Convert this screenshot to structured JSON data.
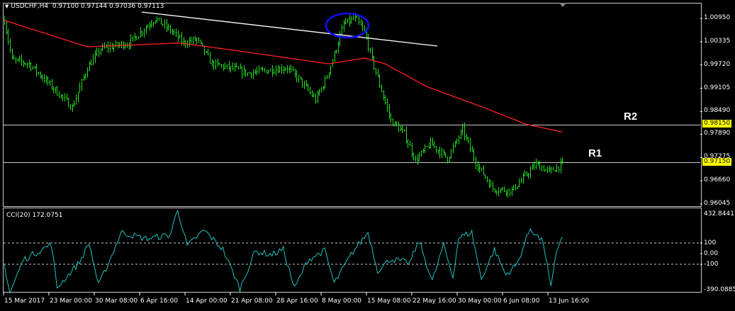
{
  "header": {
    "symbol": "USDCHF,H4",
    "open": "0.97100",
    "high": "0.97144",
    "low": "0.97036",
    "close": "0.97113"
  },
  "price_axis": [
    "1.00950",
    "1.00335",
    "0.99720",
    "0.99105",
    "0.98490",
    "0.97890",
    "0.97275",
    "0.96660",
    "0.96045"
  ],
  "levels": [
    {
      "name": "R2",
      "price": "0.98150",
      "value": 0.9815
    },
    {
      "name": "R1",
      "price": "0.97150",
      "value": 0.9715
    }
  ],
  "cci": {
    "label": "CCI(20) 172.0751",
    "axis": [
      "432.8441",
      "100",
      "0.00",
      "-100",
      "-390.0885"
    ]
  },
  "time_axis": [
    "15 Mar 2017",
    "23 Mar 00:00",
    "30 Mar 08:00",
    "6 Apr 16:00",
    "14 Apr 00:00",
    "21 Apr 08:00",
    "28 Apr 16:00",
    "8 May 00:00",
    "15 May 08:00",
    "22 May 16:00",
    "30 May 00:00",
    "6 Jun 08:00",
    "13 Jun 16:00"
  ],
  "colors": {
    "bars": "#22dd22",
    "ma": "#ff2020",
    "cci": "#20c0c0",
    "ellipse": "#1010ff",
    "tag": "#ffff00"
  },
  "chart_data": {
    "type": "ohlc",
    "price_path": [
      [
        0,
        1.009
      ],
      [
        4,
        0.9985
      ],
      [
        13,
        0.9975
      ],
      [
        23,
        0.9925
      ],
      [
        36,
        0.986
      ],
      [
        44,
        0.9965
      ],
      [
        51,
        1.0015
      ],
      [
        66,
        1.003
      ],
      [
        80,
        1.0095
      ],
      [
        89,
        1.006
      ],
      [
        95,
        1.003
      ],
      [
        102,
        1.004
      ],
      [
        110,
        0.9975
      ],
      [
        123,
        0.996
      ],
      [
        129,
        0.995
      ],
      [
        142,
        0.996
      ],
      [
        150,
        0.9965
      ],
      [
        157,
        0.993
      ],
      [
        165,
        0.988
      ],
      [
        170,
        0.993
      ],
      [
        174,
        0.9985
      ],
      [
        180,
        1.008
      ],
      [
        186,
        1.0095
      ],
      [
        191,
        1.006
      ],
      [
        195,
        0.9985
      ],
      [
        199,
        0.992
      ],
      [
        205,
        0.9825
      ],
      [
        212,
        0.979
      ],
      [
        218,
        0.972
      ],
      [
        226,
        0.9765
      ],
      [
        235,
        0.9725
      ],
      [
        243,
        0.98
      ],
      [
        250,
        0.9715
      ],
      [
        259,
        0.9645
      ],
      [
        269,
        0.964
      ],
      [
        282,
        0.971
      ],
      [
        289,
        0.969
      ],
      [
        296,
        0.971
      ]
    ],
    "ma_path": [
      [
        0,
        1.009
      ],
      [
        44,
        1.002
      ],
      [
        93,
        1.003
      ],
      [
        123,
        1.001
      ],
      [
        172,
        0.9975
      ],
      [
        191,
        0.999
      ],
      [
        202,
        0.9975
      ],
      [
        224,
        0.9915
      ],
      [
        254,
        0.986
      ],
      [
        277,
        0.9815
      ],
      [
        296,
        0.9795
      ]
    ],
    "cci_path": [
      [
        0,
        -100
      ],
      [
        3,
        -370
      ],
      [
        10,
        -60
      ],
      [
        25,
        90
      ],
      [
        28,
        -320
      ],
      [
        40,
        -80
      ],
      [
        45,
        100
      ],
      [
        50,
        -300
      ],
      [
        56,
        -60
      ],
      [
        62,
        200
      ],
      [
        75,
        140
      ],
      [
        88,
        175
      ],
      [
        92,
        420
      ],
      [
        97,
        70
      ],
      [
        106,
        220
      ],
      [
        116,
        40
      ],
      [
        125,
        -330
      ],
      [
        133,
        20
      ],
      [
        142,
        -10
      ],
      [
        148,
        40
      ],
      [
        154,
        -330
      ],
      [
        161,
        -60
      ],
      [
        170,
        30
      ],
      [
        175,
        -280
      ],
      [
        185,
        20
      ],
      [
        193,
        200
      ],
      [
        198,
        -160
      ],
      [
        205,
        -50
      ],
      [
        215,
        -90
      ],
      [
        220,
        120
      ],
      [
        227,
        -260
      ],
      [
        233,
        80
      ],
      [
        238,
        -220
      ],
      [
        241,
        150
      ],
      [
        248,
        200
      ],
      [
        253,
        -240
      ],
      [
        260,
        40
      ],
      [
        266,
        -200
      ],
      [
        272,
        -100
      ],
      [
        279,
        240
      ],
      [
        286,
        100
      ],
      [
        290,
        -330
      ],
      [
        293,
        30
      ],
      [
        296,
        172
      ]
    ]
  }
}
